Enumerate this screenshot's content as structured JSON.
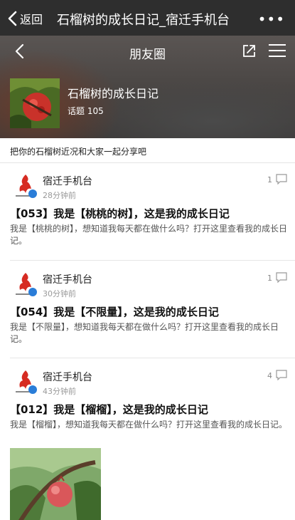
{
  "wechat_bar": {
    "back_label": "返回",
    "title": "石榴树的成长日记_宿迁手机台",
    "more_label": "•••"
  },
  "hero": {
    "title": "朋友圈",
    "topic_name": "石榴树的成长日记",
    "topic_count": "话题 105"
  },
  "description": "把你的石榴树近况和大家一起分享吧",
  "posts": [
    {
      "author": "宿迁手机台",
      "time": "28分钟前",
      "comment_count": "1",
      "title": "【053】我是【桃桃的树】，这是我的成长日记",
      "body": "我是【桃桃的树】，想知道我每天都在做什么吗？打开这里查看我的成长日记。"
    },
    {
      "author": "宿迁手机台",
      "time": "30分钟前",
      "comment_count": "1",
      "title": "【054】我是【不限量】，这是我的成长日记",
      "body": "我是【不限量】，想知道我每天都在做什么吗？打开这里查看我的成长日记。"
    },
    {
      "author": "宿迁手机台",
      "time": "43分钟前",
      "comment_count": "4",
      "title": "【012】我是【榴榴】，这是我的成长日记",
      "body": "我是【榴榴】，想知道我每天都在做什么吗？打开这里查看我的成长日记。"
    }
  ],
  "colors": {
    "wechat_bar": "#2e2e2e",
    "verified_badge": "#2a7dd8",
    "logo_red": "#d62b22"
  },
  "icons": [
    "chevron-left-icon",
    "share-icon",
    "menu-icon",
    "comment-icon",
    "verified-icon"
  ]
}
